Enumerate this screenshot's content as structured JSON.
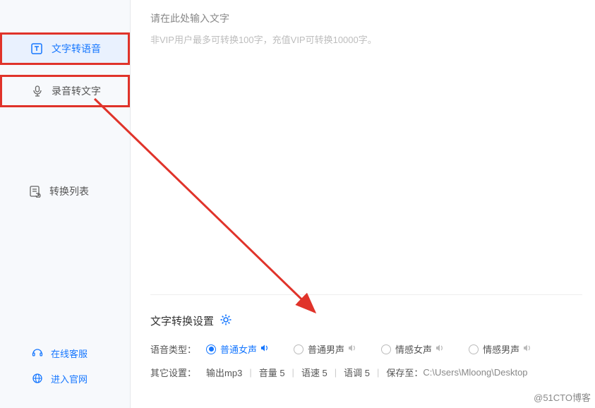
{
  "sidebar": {
    "items": [
      {
        "label": "文字转语音",
        "icon": "text-to-speech-icon"
      },
      {
        "label": "录音转文字",
        "icon": "speech-to-text-icon"
      },
      {
        "label": "转换列表",
        "icon": "convert-list-icon"
      }
    ],
    "bottom": [
      {
        "label": "在线客服",
        "icon": "support-icon"
      },
      {
        "label": "进入官网",
        "icon": "globe-icon"
      }
    ]
  },
  "main": {
    "input_placeholder": "请在此处输入文字",
    "input_hint": "非VIP用户最多可转换100字，充值VIP可转换10000字。"
  },
  "settings": {
    "title": "文字转换设置",
    "voice_label": "语音类型：",
    "voices": [
      {
        "label": "普通女声",
        "selected": true
      },
      {
        "label": "普通男声",
        "selected": false
      },
      {
        "label": "情感女声",
        "selected": false
      },
      {
        "label": "情感男声",
        "selected": false
      }
    ],
    "other_label": "其它设置：",
    "output_format": "输出mp3",
    "volume_label": "音量 5",
    "speed_label": "语速 5",
    "pitch_label": "语调 5",
    "save_label": "保存至：",
    "save_path": "C:\\Users\\Mloong\\Desktop"
  },
  "watermark": "@51CTO博客"
}
